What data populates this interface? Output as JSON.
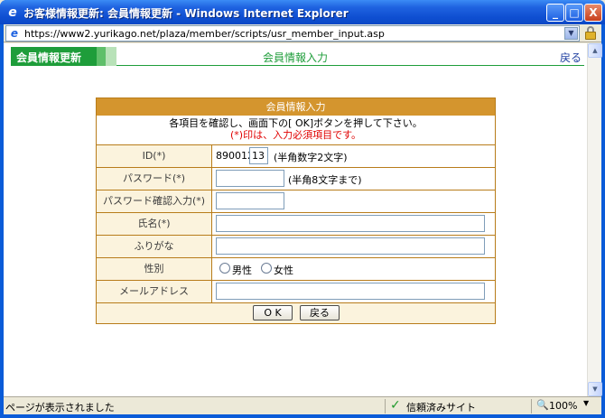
{
  "window": {
    "title": "お客様情報更新: 会員情報更新 - Windows Internet Explorer",
    "minimize": "_",
    "maximize": "□",
    "close": "X"
  },
  "address": {
    "url": "https://www2.yurikago.net/plaza/member/scripts/usr_member_input.asp"
  },
  "header": {
    "section_title": "会員情報更新",
    "page_title": "会員情報入力",
    "back_link": "戻る"
  },
  "form": {
    "heading": "会員情報入力",
    "instruction": "各項目を確認し、画面下の[ OK]ボタンを押して下さい。",
    "required_note": "(*)印は、入力必須項目です。",
    "fields": {
      "id": {
        "label": "ID(*)",
        "prefix": "890012",
        "value": "13",
        "hint": "(半角数字2文字)"
      },
      "password": {
        "label": "パスワード(*)",
        "value": "",
        "hint": "(半角8文字まで)"
      },
      "password_confirm": {
        "label": "パスワード確認入力(*)",
        "value": ""
      },
      "name": {
        "label": "氏名(*)",
        "value": ""
      },
      "furigana": {
        "label": "ふりがな",
        "value": ""
      },
      "gender": {
        "label": "性別",
        "options": [
          "男性",
          "女性"
        ]
      },
      "email": {
        "label": "メールアドレス",
        "value": ""
      }
    },
    "ok_button": "O K",
    "back_button": "戻る"
  },
  "statusbar": {
    "text": "ページが表示されました",
    "trust": "信頼済みサイト",
    "zoom": "100%"
  }
}
